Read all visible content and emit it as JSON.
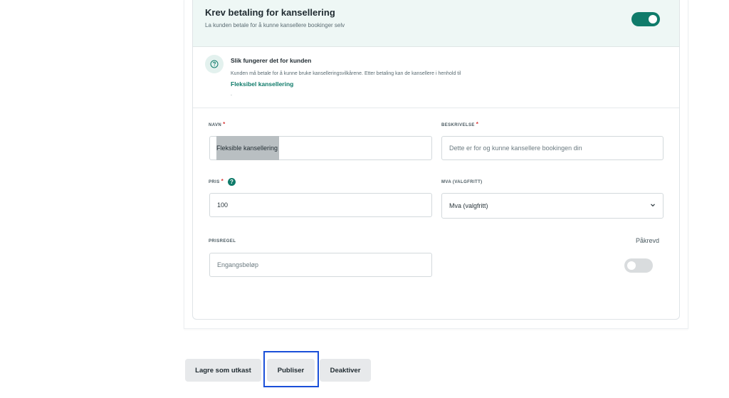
{
  "section": {
    "title": "Krev betaling for kansellering",
    "subtitle": "La kunden betale for å kunne kansellere bookinger selv",
    "toggle_on": true
  },
  "info": {
    "icon": "question-circle-icon",
    "title": "Slik fungerer det for kunden",
    "text": "Kunden må betale for å kunne bruke kanselleringsvilkårene. Etter betaling kan de kansellere i henhold til",
    "link": "Fleksibel kansellering",
    "trailing": "."
  },
  "form": {
    "navn": {
      "label": "NAVN",
      "required_mark": "*",
      "value": "Fleksible kansellering"
    },
    "beskrivelse": {
      "label": "BESKRIVELSE",
      "required_mark": "*",
      "placeholder": "Dette er for og kunne kansellere bookingen din"
    },
    "pris": {
      "label": "PRIS",
      "required_mark": "*",
      "help_glyph": "?",
      "value": "100"
    },
    "mva": {
      "label": "MVA (VALGFRITT)",
      "selected": "Mva (valgfritt)"
    },
    "prisregel": {
      "label": "PRISREGEL",
      "placeholder": "Engangsbeløp"
    },
    "paakrevd": {
      "label": "Påkrevd",
      "toggle_on": false
    }
  },
  "actions": {
    "draft": "Lagre som utkast",
    "publish": "Publiser",
    "deactivate": "Deaktiver"
  },
  "colors": {
    "accent": "#0f7b6a",
    "header_bg": "#eef7f5",
    "required": "#d93a3a",
    "focus": "#1a4fd8"
  }
}
